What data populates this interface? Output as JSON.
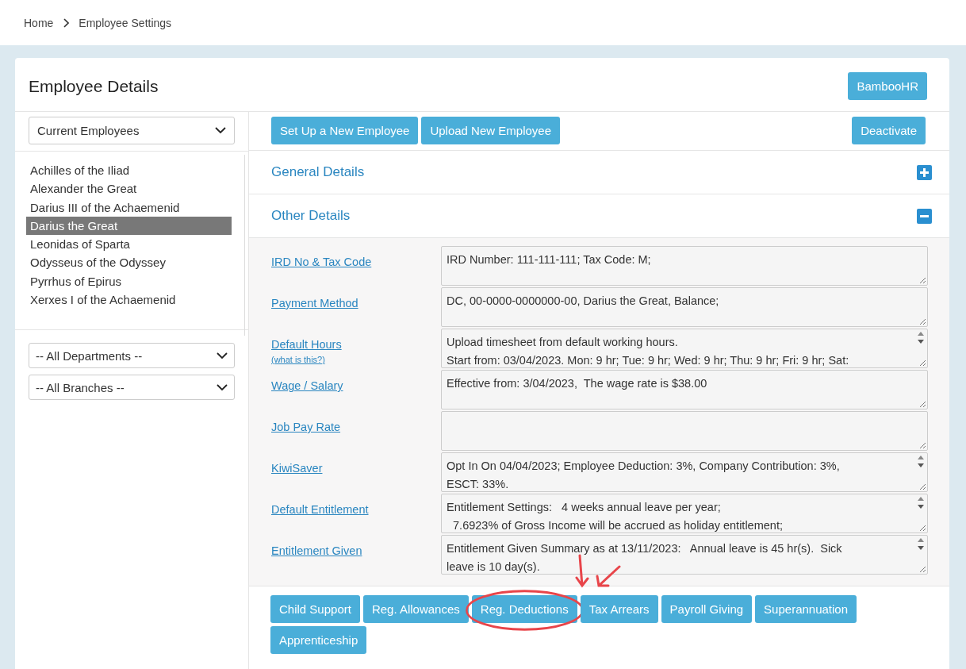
{
  "breadcrumb": [
    "Home",
    "Employee Settings"
  ],
  "panel": {
    "title": "Employee Details",
    "header_button": "BambooHR"
  },
  "employee_filter": {
    "value": "Current Employees"
  },
  "employees": [
    {
      "name": "Achilles of the Iliad",
      "selected": false
    },
    {
      "name": "Alexander the Great",
      "selected": false
    },
    {
      "name": "Darius III of the Achaemenid",
      "selected": false
    },
    {
      "name": "Darius the Great",
      "selected": true
    },
    {
      "name": "Leonidas of Sparta",
      "selected": false
    },
    {
      "name": "Odysseus of the Odyssey",
      "selected": false
    },
    {
      "name": "Pyrrhus of Epirus",
      "selected": false
    },
    {
      "name": "Xerxes I of the Achaemenid",
      "selected": false
    }
  ],
  "filters": [
    {
      "value": "-- All Departments --"
    },
    {
      "value": "-- All Branches --"
    }
  ],
  "toolbar": {
    "left_buttons": [
      "Set Up a New Employee",
      "Upload New Employee"
    ],
    "right_button": "Deactivate"
  },
  "sections": [
    {
      "title": "General Details",
      "expanded": false
    },
    {
      "title": "Other Details",
      "expanded": true
    }
  ],
  "fields": [
    {
      "label": "IRD No & Tax Code",
      "lines": [
        "IRD Number: 111-111-111; Tax Code: M;"
      ],
      "scrollbar": false
    },
    {
      "label": "Payment Method",
      "lines": [
        "DC, 00-0000-0000000-00, Darius the Great, Balance;"
      ],
      "scrollbar": false
    },
    {
      "label": "Default Hours",
      "help": "(what is this?)",
      "lines": [
        "Upload timesheet from default working hours.",
        "Start from: 03/04/2023. Mon: 9 hr; Tue: 9 hr; Wed: 9 hr; Thu: 9 hr; Fri: 9 hr; Sat:"
      ],
      "scrollbar": true
    },
    {
      "label": "Wage / Salary",
      "lines": [
        "Effective from: 3/04/2023,  The wage rate is $38.00"
      ],
      "scrollbar": false
    },
    {
      "label": "Job Pay Rate",
      "scrollbar": false
    },
    {
      "label": "KiwiSaver",
      "lines": [
        "Opt In On 04/04/2023; Employee Deduction: 3%, Company Contribution: 3%,",
        "ESCT: 33%."
      ],
      "scrollbar": true
    },
    {
      "label": "Default Entitlement",
      "lines": [
        "Entitlement Settings:   4 weeks annual leave per year;",
        "  7.6923% of Gross Income will be accrued as holiday entitlement;"
      ],
      "scrollbar": true
    },
    {
      "label": "Entitlement Given",
      "lines": [
        "Entitlement Given Summary as at 13/11/2023:   Annual leave is 45 hr(s).  Sick",
        "leave is 10 day(s)."
      ],
      "scrollbar": true
    }
  ],
  "action_buttons": [
    {
      "label": "Child Support",
      "highlighted": false
    },
    {
      "label": "Reg. Allowances",
      "highlighted": false
    },
    {
      "label": "Reg. Deductions",
      "highlighted": true
    },
    {
      "label": "Tax Arrears",
      "highlighted": false
    },
    {
      "label": "Payroll Giving",
      "highlighted": false
    },
    {
      "label": "Superannuation",
      "highlighted": false
    },
    {
      "label": "Apprenticeship",
      "highlighted": false
    }
  ]
}
